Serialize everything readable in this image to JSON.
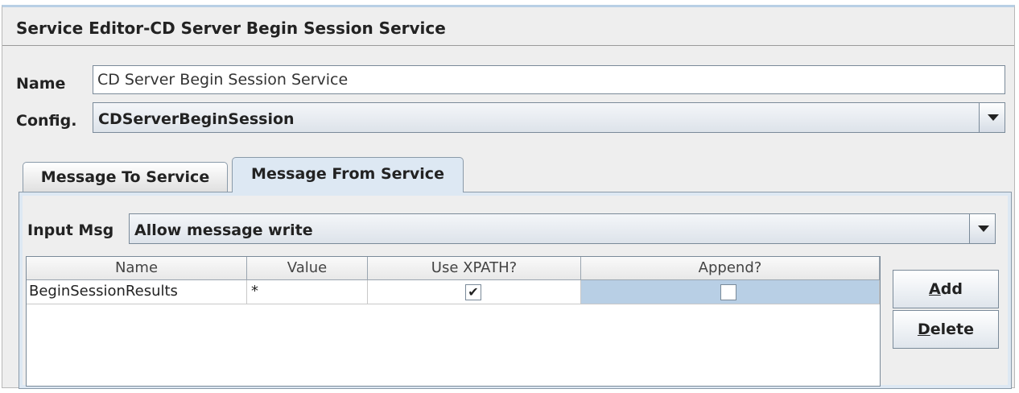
{
  "window": {
    "title": "Service Editor-CD Server Begin Session Service"
  },
  "form": {
    "name_label": "Name",
    "name_value": "CD Server Begin Session Service",
    "config_label": "Config.",
    "config_value": "CDServerBeginSession"
  },
  "tabs": [
    {
      "label": "Message To Service",
      "active": false
    },
    {
      "label": "Message From Service",
      "active": true
    }
  ],
  "input_msg": {
    "label": "Input Msg",
    "value": "Allow message write"
  },
  "table": {
    "columns": [
      "Name",
      "Value",
      "Use XPATH?",
      "Append?"
    ],
    "rows": [
      {
        "name": "BeginSessionResults",
        "value": "*",
        "use_xpath": true,
        "append": false
      }
    ]
  },
  "buttons": {
    "add": {
      "mnemonic": "A",
      "rest": "dd"
    },
    "delete": {
      "mnemonic": "D",
      "rest": "elete"
    }
  },
  "colors": {
    "selection": "#b8cfe5",
    "tab_active": "#dde8f3"
  }
}
